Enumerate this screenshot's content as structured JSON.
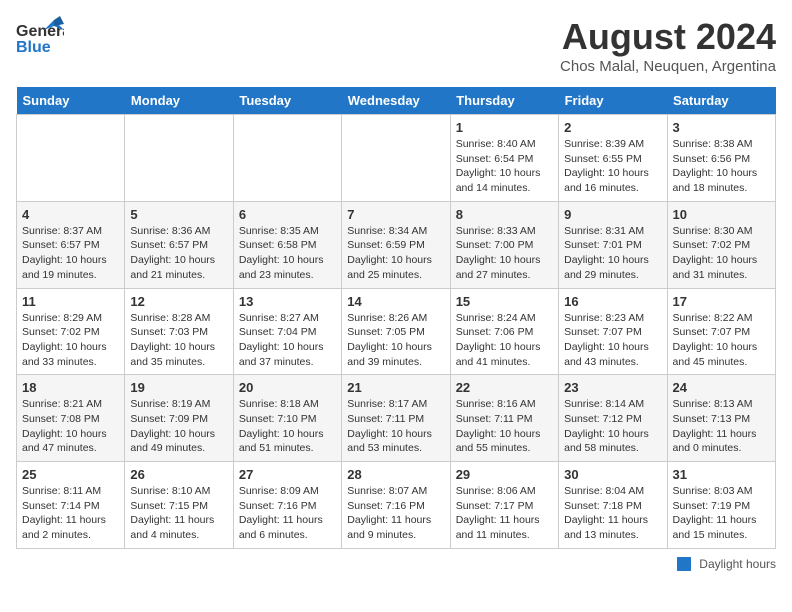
{
  "header": {
    "logo_general": "General",
    "logo_blue": "Blue",
    "title": "August 2024",
    "subtitle": "Chos Malal, Neuquen, Argentina"
  },
  "days_of_week": [
    "Sunday",
    "Monday",
    "Tuesday",
    "Wednesday",
    "Thursday",
    "Friday",
    "Saturday"
  ],
  "weeks": [
    [
      {
        "num": "",
        "text": ""
      },
      {
        "num": "",
        "text": ""
      },
      {
        "num": "",
        "text": ""
      },
      {
        "num": "",
        "text": ""
      },
      {
        "num": "1",
        "text": "Sunrise: 8:40 AM\nSunset: 6:54 PM\nDaylight: 10 hours\nand 14 minutes."
      },
      {
        "num": "2",
        "text": "Sunrise: 8:39 AM\nSunset: 6:55 PM\nDaylight: 10 hours\nand 16 minutes."
      },
      {
        "num": "3",
        "text": "Sunrise: 8:38 AM\nSunset: 6:56 PM\nDaylight: 10 hours\nand 18 minutes."
      }
    ],
    [
      {
        "num": "4",
        "text": "Sunrise: 8:37 AM\nSunset: 6:57 PM\nDaylight: 10 hours\nand 19 minutes."
      },
      {
        "num": "5",
        "text": "Sunrise: 8:36 AM\nSunset: 6:57 PM\nDaylight: 10 hours\nand 21 minutes."
      },
      {
        "num": "6",
        "text": "Sunrise: 8:35 AM\nSunset: 6:58 PM\nDaylight: 10 hours\nand 23 minutes."
      },
      {
        "num": "7",
        "text": "Sunrise: 8:34 AM\nSunset: 6:59 PM\nDaylight: 10 hours\nand 25 minutes."
      },
      {
        "num": "8",
        "text": "Sunrise: 8:33 AM\nSunset: 7:00 PM\nDaylight: 10 hours\nand 27 minutes."
      },
      {
        "num": "9",
        "text": "Sunrise: 8:31 AM\nSunset: 7:01 PM\nDaylight: 10 hours\nand 29 minutes."
      },
      {
        "num": "10",
        "text": "Sunrise: 8:30 AM\nSunset: 7:02 PM\nDaylight: 10 hours\nand 31 minutes."
      }
    ],
    [
      {
        "num": "11",
        "text": "Sunrise: 8:29 AM\nSunset: 7:02 PM\nDaylight: 10 hours\nand 33 minutes."
      },
      {
        "num": "12",
        "text": "Sunrise: 8:28 AM\nSunset: 7:03 PM\nDaylight: 10 hours\nand 35 minutes."
      },
      {
        "num": "13",
        "text": "Sunrise: 8:27 AM\nSunset: 7:04 PM\nDaylight: 10 hours\nand 37 minutes."
      },
      {
        "num": "14",
        "text": "Sunrise: 8:26 AM\nSunset: 7:05 PM\nDaylight: 10 hours\nand 39 minutes."
      },
      {
        "num": "15",
        "text": "Sunrise: 8:24 AM\nSunset: 7:06 PM\nDaylight: 10 hours\nand 41 minutes."
      },
      {
        "num": "16",
        "text": "Sunrise: 8:23 AM\nSunset: 7:07 PM\nDaylight: 10 hours\nand 43 minutes."
      },
      {
        "num": "17",
        "text": "Sunrise: 8:22 AM\nSunset: 7:07 PM\nDaylight: 10 hours\nand 45 minutes."
      }
    ],
    [
      {
        "num": "18",
        "text": "Sunrise: 8:21 AM\nSunset: 7:08 PM\nDaylight: 10 hours\nand 47 minutes."
      },
      {
        "num": "19",
        "text": "Sunrise: 8:19 AM\nSunset: 7:09 PM\nDaylight: 10 hours\nand 49 minutes."
      },
      {
        "num": "20",
        "text": "Sunrise: 8:18 AM\nSunset: 7:10 PM\nDaylight: 10 hours\nand 51 minutes."
      },
      {
        "num": "21",
        "text": "Sunrise: 8:17 AM\nSunset: 7:11 PM\nDaylight: 10 hours\nand 53 minutes."
      },
      {
        "num": "22",
        "text": "Sunrise: 8:16 AM\nSunset: 7:11 PM\nDaylight: 10 hours\nand 55 minutes."
      },
      {
        "num": "23",
        "text": "Sunrise: 8:14 AM\nSunset: 7:12 PM\nDaylight: 10 hours\nand 58 minutes."
      },
      {
        "num": "24",
        "text": "Sunrise: 8:13 AM\nSunset: 7:13 PM\nDaylight: 11 hours\nand 0 minutes."
      }
    ],
    [
      {
        "num": "25",
        "text": "Sunrise: 8:11 AM\nSunset: 7:14 PM\nDaylight: 11 hours\nand 2 minutes."
      },
      {
        "num": "26",
        "text": "Sunrise: 8:10 AM\nSunset: 7:15 PM\nDaylight: 11 hours\nand 4 minutes."
      },
      {
        "num": "27",
        "text": "Sunrise: 8:09 AM\nSunset: 7:16 PM\nDaylight: 11 hours\nand 6 minutes."
      },
      {
        "num": "28",
        "text": "Sunrise: 8:07 AM\nSunset: 7:16 PM\nDaylight: 11 hours\nand 9 minutes."
      },
      {
        "num": "29",
        "text": "Sunrise: 8:06 AM\nSunset: 7:17 PM\nDaylight: 11 hours\nand 11 minutes."
      },
      {
        "num": "30",
        "text": "Sunrise: 8:04 AM\nSunset: 7:18 PM\nDaylight: 11 hours\nand 13 minutes."
      },
      {
        "num": "31",
        "text": "Sunrise: 8:03 AM\nSunset: 7:19 PM\nDaylight: 11 hours\nand 15 minutes."
      }
    ]
  ],
  "legend": {
    "label": "Daylight hours"
  }
}
